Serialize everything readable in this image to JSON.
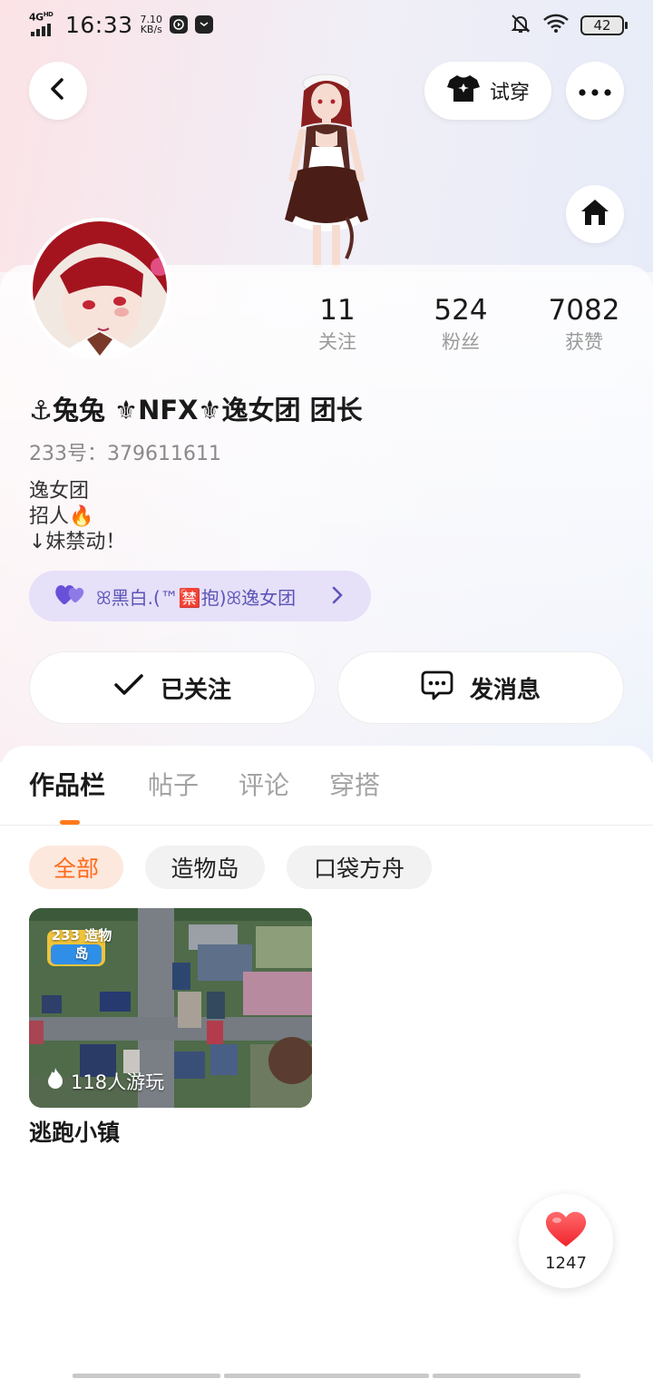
{
  "status_bar": {
    "network": "4G",
    "network_sup": "HD",
    "time": "16:33",
    "speed_value": "7.10",
    "speed_unit": "KB/s",
    "battery": "42"
  },
  "header": {
    "try_on_label": "试穿"
  },
  "profile": {
    "stats": [
      {
        "value": "11",
        "label": "关注"
      },
      {
        "value": "524",
        "label": "粉丝"
      },
      {
        "value": "7082",
        "label": "获赞"
      }
    ],
    "username": "⚓兔兔 ⚜NFX⚜逸女团 团长",
    "id_text": "233号：379611611",
    "bio_lines": [
      "逸女团",
      "招人🔥",
      "↓妹禁动！"
    ],
    "group_name": "ꕤ黑白.(™🈲抱)ꕤ逸女团",
    "follow_label": "已关注",
    "message_label": "发消息"
  },
  "tabs": [
    "作品栏",
    "帖子",
    "评论",
    "穿搭"
  ],
  "filters": [
    "全部",
    "造物岛",
    "口袋方舟"
  ],
  "works": [
    {
      "title": "逃跑小镇",
      "plays": "118人游玩",
      "badge": "233 造物岛"
    }
  ],
  "like_button": {
    "count": "1247"
  },
  "colors": {
    "accent": "#ff7a1a",
    "group_pill_bg": "#e6e0f9",
    "group_pill_text": "#5b54b8"
  }
}
